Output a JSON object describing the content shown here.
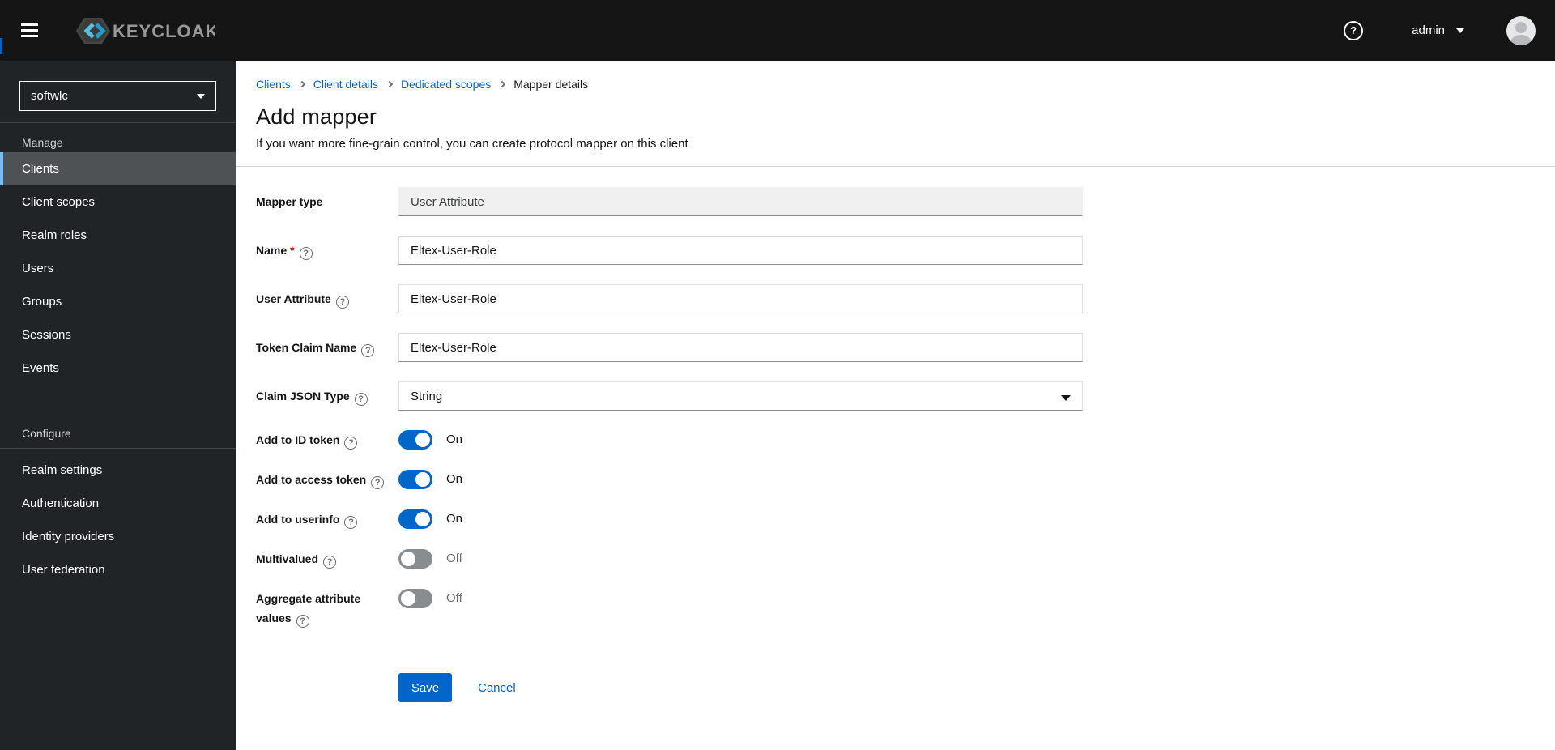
{
  "masthead": {
    "brand_text": "KEYCLOAK",
    "username": "admin"
  },
  "icons": {
    "help": "?"
  },
  "sidebar": {
    "realm": "softwlc",
    "manage_label": "Manage",
    "manage_items": [
      "Clients",
      "Client scopes",
      "Realm roles",
      "Users",
      "Groups",
      "Sessions",
      "Events"
    ],
    "active_item": "Clients",
    "configure_label": "Configure",
    "configure_items": [
      "Realm settings",
      "Authentication",
      "Identity providers",
      "User federation"
    ]
  },
  "breadcrumb": {
    "items": [
      "Clients",
      "Client details",
      "Dedicated scopes",
      "Mapper details"
    ]
  },
  "page_header": {
    "title": "Add mapper",
    "subtitle": "If you want more fine-grain control, you can create protocol mapper on this client"
  },
  "form": {
    "mapper_type": {
      "label": "Mapper type",
      "value": "User Attribute"
    },
    "name": {
      "label": "Name",
      "required_marker": "*",
      "value": "Eltex-User-Role"
    },
    "user_attribute": {
      "label": "User Attribute",
      "value": "Eltex-User-Role"
    },
    "token_claim_name": {
      "label": "Token Claim Name",
      "value": "Eltex-User-Role"
    },
    "claim_json_type": {
      "label": "Claim JSON Type",
      "value": "String"
    },
    "toggles": [
      {
        "label": "Add to ID token",
        "state": "On"
      },
      {
        "label": "Add to access token",
        "state": "On"
      },
      {
        "label": "Add to userinfo",
        "state": "On"
      },
      {
        "label": "Multivalued",
        "state": "Off"
      },
      {
        "label": "Aggregate attribute values",
        "state": "Off"
      }
    ],
    "actions": {
      "save": "Save",
      "cancel": "Cancel"
    }
  },
  "colors": {
    "masthead_bg": "#151515",
    "sidebar_bg": "#212427",
    "accent_blue": "#0066cc",
    "nav_active_indicator": "#73bcf7",
    "nav_active_bg": "#4f5255",
    "toggle_off_gray": "#8a8d90",
    "link_blue": "#0066cc",
    "required_red": "#c9190b"
  }
}
